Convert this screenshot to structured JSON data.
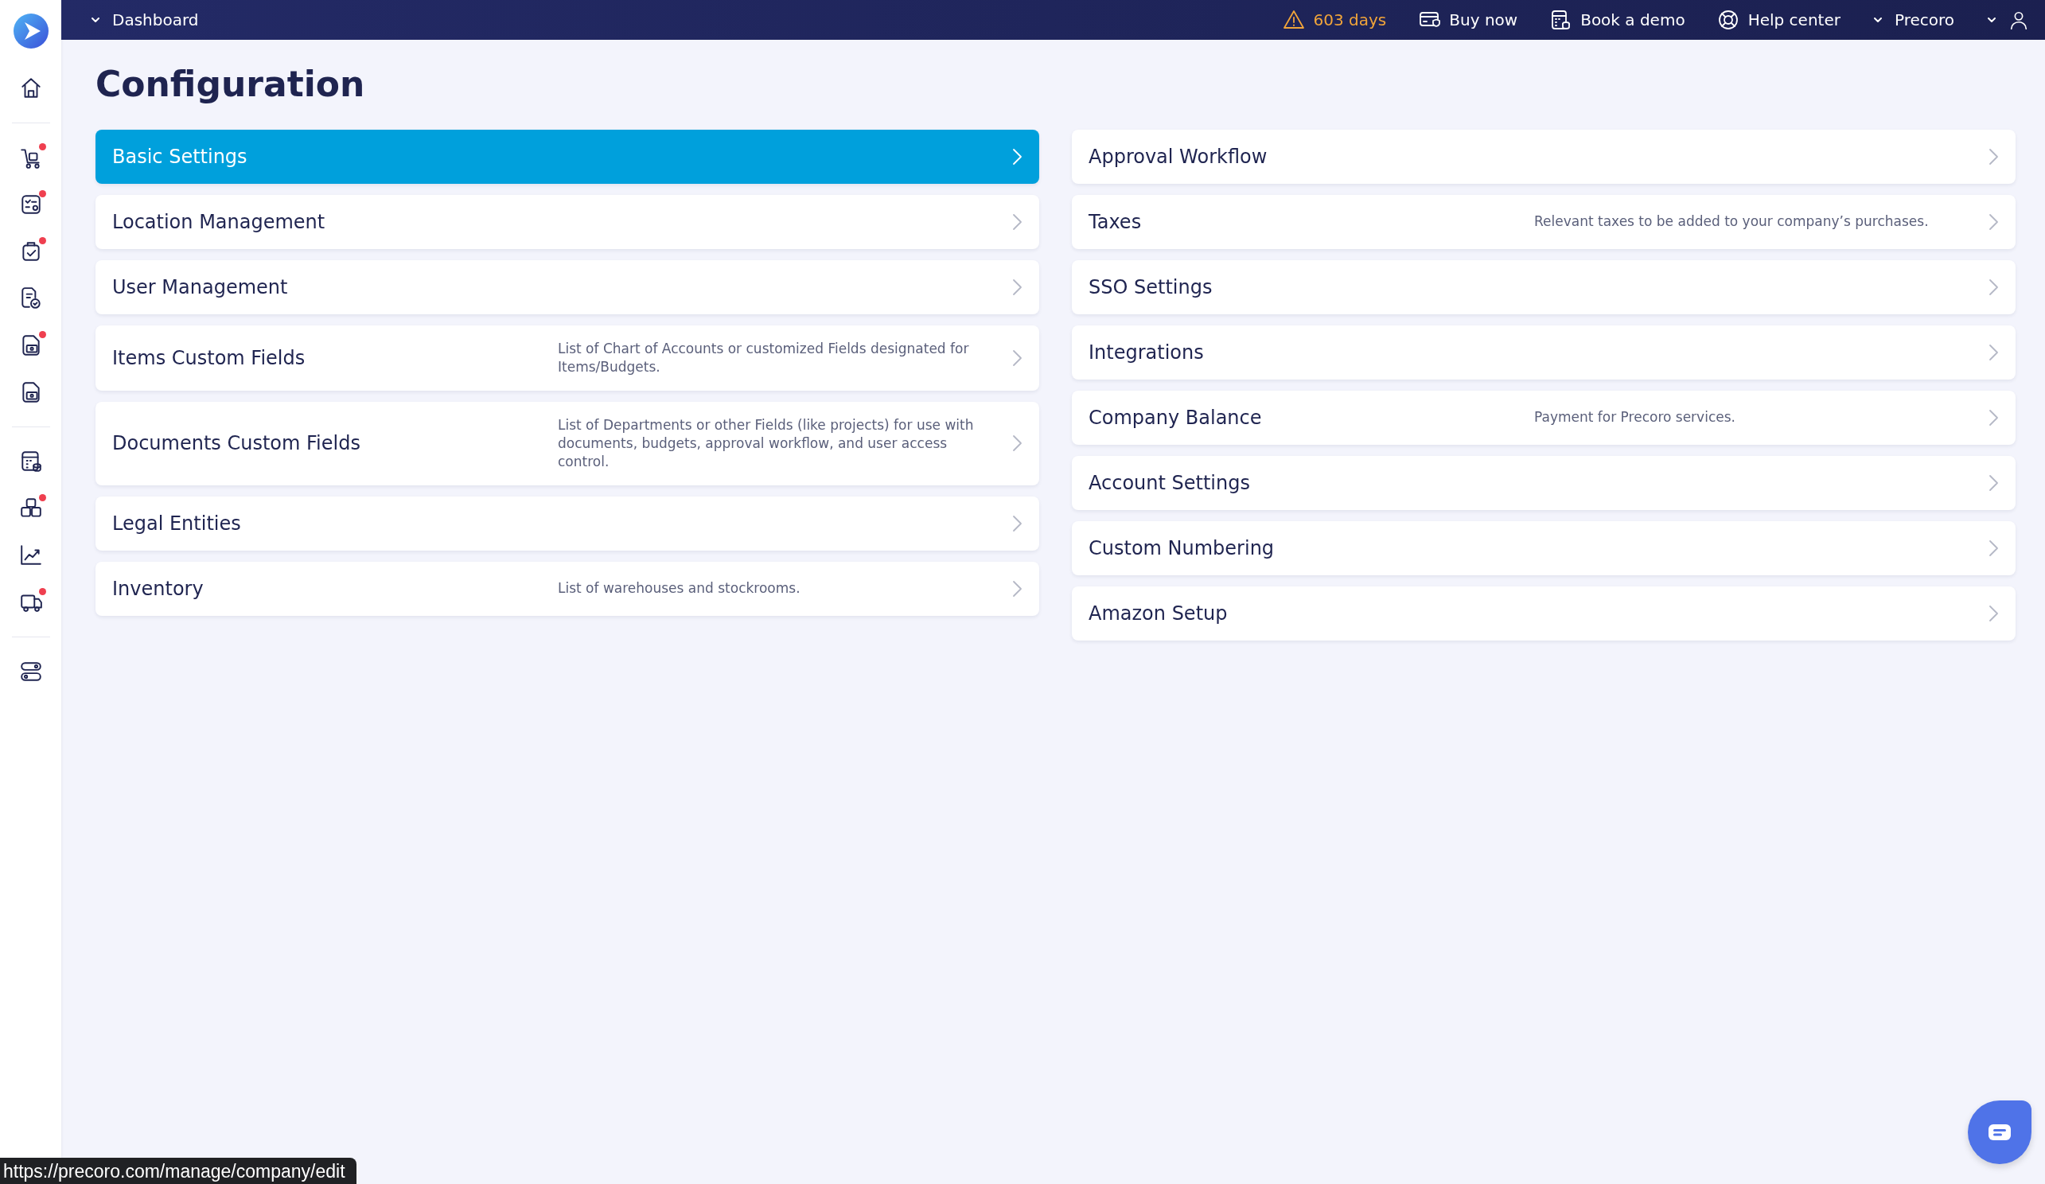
{
  "sidebar": {
    "groups": [
      {
        "items": [
          {
            "kind": "home",
            "badge": false
          }
        ]
      },
      {
        "items": [
          {
            "kind": "cart",
            "badge": true
          },
          {
            "kind": "checklist",
            "badge": true
          },
          {
            "kind": "clipboard",
            "badge": true
          },
          {
            "kind": "document",
            "badge": false
          },
          {
            "kind": "invoice",
            "badge": true
          },
          {
            "kind": "payment",
            "badge": false
          }
        ]
      },
      {
        "items": [
          {
            "kind": "budget",
            "badge": false
          },
          {
            "kind": "boxes",
            "badge": true
          },
          {
            "kind": "chart",
            "badge": false
          },
          {
            "kind": "truck",
            "badge": true
          }
        ]
      },
      {
        "items": [
          {
            "kind": "toggles",
            "badge": false
          }
        ]
      }
    ]
  },
  "top_bar": {
    "breadcrumb": "Dashboard",
    "trial": "603 days",
    "links": [
      {
        "kind": "card",
        "label": "Buy now"
      },
      {
        "kind": "calc",
        "label": "Book a demo"
      },
      {
        "kind": "help",
        "label": "Help center"
      }
    ],
    "company": "Precoro"
  },
  "title": "Configuration",
  "columns": [
    [
      {
        "title": "Basic Settings",
        "selected": true
      },
      {
        "title": "Location Management",
        "selected": false
      },
      {
        "title": "User Management",
        "selected": false
      },
      {
        "title": "Items Custom Fields",
        "description": "List of Chart of Accounts or customized Fields designated for Items/Budgets.",
        "selected": false
      },
      {
        "title": "Documents Custom Fields",
        "description": "List of Departments or other Fields (like projects) for use with documents, budgets, approval workflow, and user access control.",
        "selected": false
      },
      {
        "title": "Legal Entities",
        "selected": false
      },
      {
        "title": "Inventory",
        "description": "List of warehouses and stockrooms.",
        "selected": false
      }
    ],
    [
      {
        "title": "Approval Workflow",
        "selected": false
      },
      {
        "title": "Taxes",
        "description": "Relevant taxes to be added to your company’s purchases.",
        "selected": false
      },
      {
        "title": "SSO Settings",
        "selected": false
      },
      {
        "title": "Integrations",
        "selected": false
      },
      {
        "title": "Company Balance",
        "description": "Payment for Precoro services.",
        "selected": false
      },
      {
        "title": "Account Settings",
        "selected": false
      },
      {
        "title": "Custom Numbering",
        "selected": false
      },
      {
        "title": "Amazon Setup",
        "selected": false
      }
    ]
  ],
  "status_url": "https://precoro.com/manage/company/edit"
}
